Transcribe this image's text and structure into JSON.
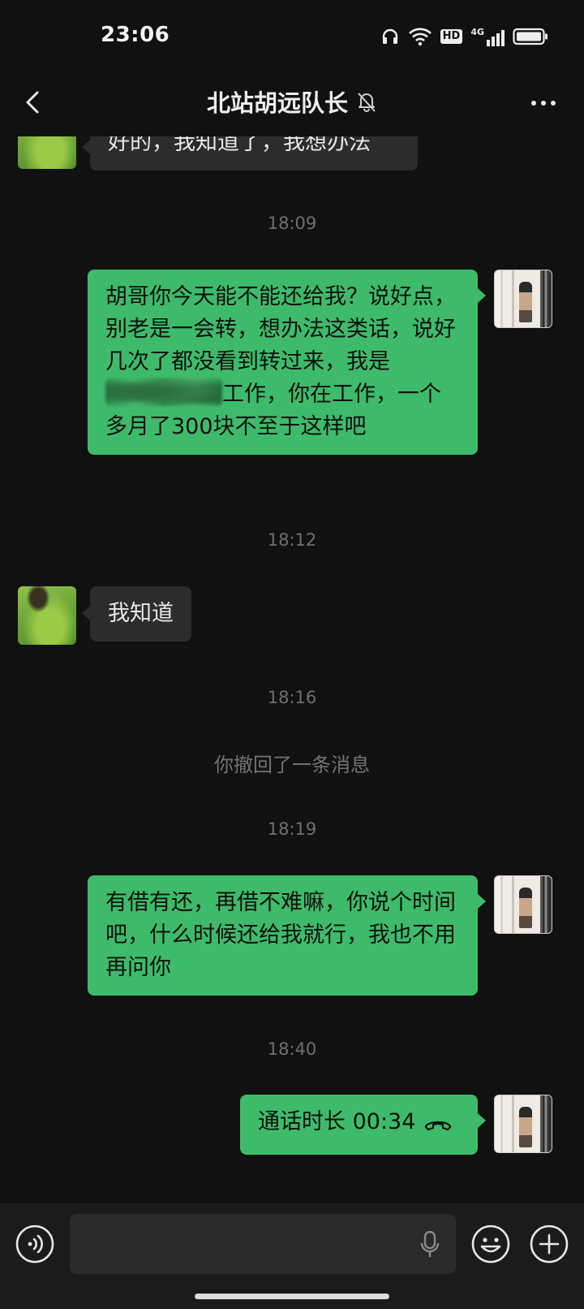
{
  "status_bar": {
    "time": "23:06",
    "network_label": "4G",
    "hd_label": "HD"
  },
  "nav": {
    "title": "北站胡远队长",
    "muted": true
  },
  "messages": [
    {
      "side": "in",
      "text": "好的，我知道了，我想办法",
      "avatar": "grass-avatar"
    },
    {
      "type": "time",
      "text": "18:09"
    },
    {
      "side": "out",
      "lines_before": "胡哥你今天能不能还给我？说好点，别老是一会转，想办法这类话，说好几次了都没看到转过来，我是",
      "lines_after": "工作，你在工作，一个多月了300块不至于这样吧",
      "redacted": true,
      "avatar": "room-avatar"
    },
    {
      "type": "time",
      "text": "18:12"
    },
    {
      "side": "in",
      "text": "我知道",
      "avatar": "grass-avatar"
    },
    {
      "type": "time",
      "text": "18:16"
    },
    {
      "type": "system",
      "text": "你撤回了一条消息"
    },
    {
      "type": "time",
      "text": "18:19"
    },
    {
      "side": "out",
      "text": "有借有还，再借不难嘛，你说个时间吧，什么时候还给我就行，我也不用再问你",
      "avatar": "room-avatar"
    },
    {
      "type": "time",
      "text": "18:40"
    },
    {
      "side": "out",
      "text": "通话时长 00:34",
      "call": true,
      "avatar": "room-avatar"
    }
  ],
  "colors": {
    "background": "#111111",
    "bubble_out": "#3ebb6a",
    "bubble_in": "#2c2c2c",
    "timestamp": "#6f6f6f"
  },
  "icons": {
    "back": "chevron-left-icon",
    "mute": "bell-off-icon",
    "more": "more-dots-icon",
    "voice": "voice-mode-icon",
    "mic": "microphone-icon",
    "emoji": "emoji-icon",
    "plus": "plus-icon",
    "call": "phone-hangup-icon"
  }
}
